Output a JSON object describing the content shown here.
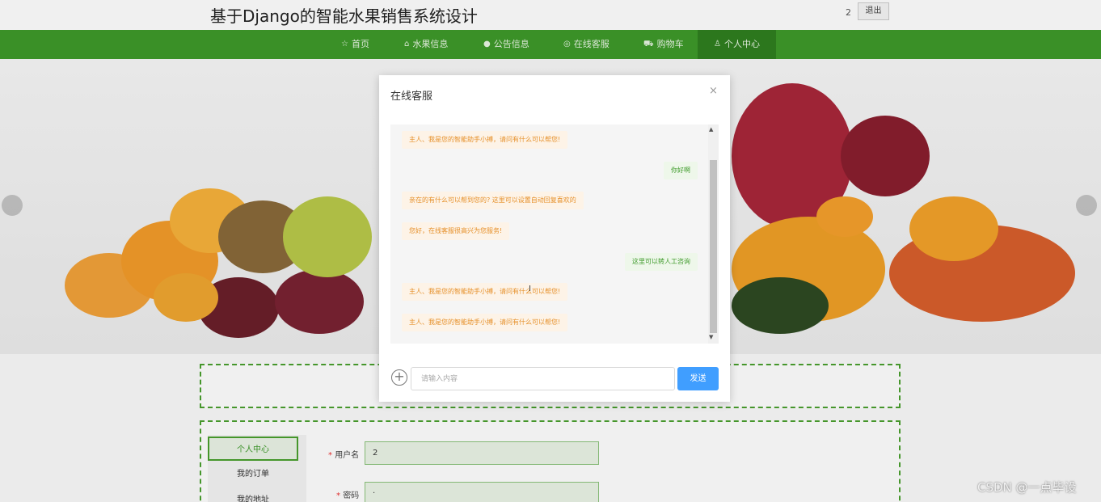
{
  "header": {
    "title": "基于Django的智能水果销售系统设计",
    "user_id": "2",
    "logout_label": "退出"
  },
  "nav": {
    "items": [
      {
        "label": "首页",
        "icon": "star-icon"
      },
      {
        "label": "水果信息",
        "icon": "home-icon"
      },
      {
        "label": "公告信息",
        "icon": "info-icon"
      },
      {
        "label": "在线客服",
        "icon": "headset-icon"
      },
      {
        "label": "购物车",
        "icon": "cart-icon"
      },
      {
        "label": "个人中心",
        "icon": "user-icon"
      }
    ],
    "active": "个人中心"
  },
  "modal": {
    "title": "在线客服",
    "close_label": "×",
    "messages": [
      {
        "from": "bot",
        "text": "主人、我是您的智能助手小搏，请问有什么可以帮您!"
      },
      {
        "from": "user",
        "text": "你好啊"
      },
      {
        "from": "bot",
        "text": "亲在的有什么可以帮到您的?  这里可以设置自动回复喜欢的"
      },
      {
        "from": "bot",
        "text": "您好，在线客服很高兴为您服务!"
      },
      {
        "from": "user",
        "text": "这里可以转人工咨询"
      },
      {
        "from": "bot",
        "text": "主人、我是您的智能助手小搏，请问有什么可以帮您!"
      },
      {
        "from": "bot",
        "text": "主人、我是您的智能助手小搏，请问有什么可以帮您!"
      }
    ],
    "input_placeholder": "请输入内容",
    "send_label": "发送",
    "plus_label": "+"
  },
  "sidebar": {
    "items": [
      "个人中心",
      "我的订单",
      "我的地址"
    ]
  },
  "form": {
    "username_label": "用户名",
    "username_value": "2",
    "password_label": "密码",
    "password_value": "·",
    "required_mark": "*"
  },
  "watermark": "CSDN @一点毕设",
  "colors": {
    "nav_green": "#3e9a2a",
    "send_blue": "#409eff",
    "bot_text": "#e6902a",
    "user_text": "#3e9a2a"
  }
}
